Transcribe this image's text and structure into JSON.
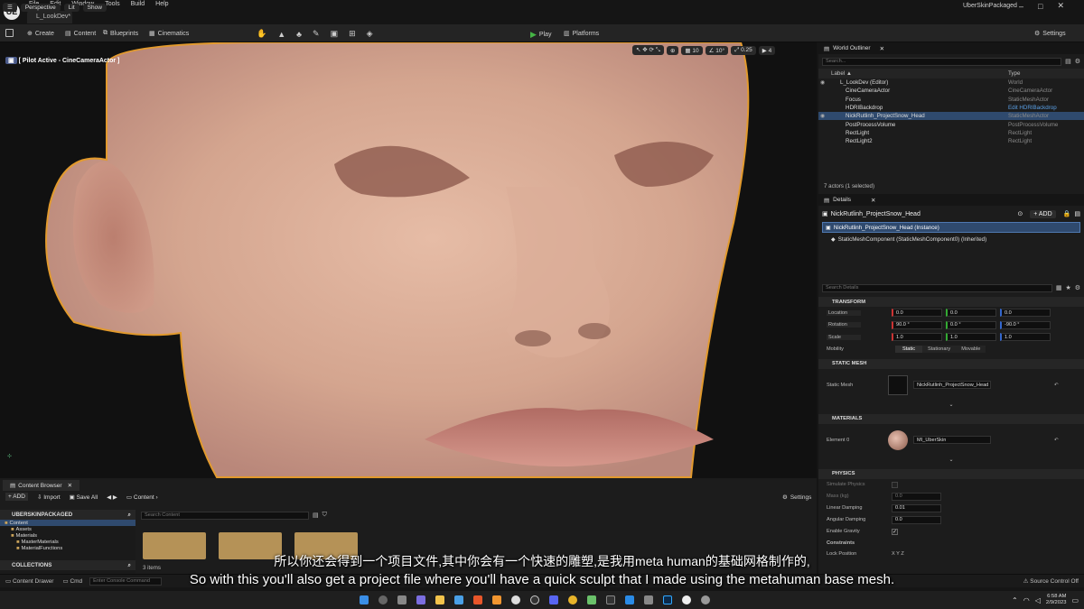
{
  "app": {
    "project_name": "UberSkinPackaged",
    "level_tab": "L_LookDev*",
    "logo": "UE"
  },
  "menu": [
    "File",
    "Edit",
    "Window",
    "Tools",
    "Build",
    "Help"
  ],
  "toolbar": {
    "create": "Create",
    "content": "Content",
    "blueprints": "Blueprints",
    "cinematics": "Cinematics",
    "play": "Play",
    "platforms": "Platforms",
    "settings": "Settings"
  },
  "viewport": {
    "perspective": "Perspective",
    "lit": "Lit",
    "show": "Show",
    "pilot": "[ Pilot Active - CineCameraActor ]",
    "grid_value": "10",
    "angle_value": "10°",
    "scale_value": "0.25",
    "camera_speed": "4"
  },
  "outliner": {
    "title": "World Outliner",
    "search_placeholder": "Search...",
    "col_label": "Label ▲",
    "col_type": "Type",
    "rows": [
      {
        "label": "L_LookDev (Editor)",
        "type": "World"
      },
      {
        "label": "CineCameraActor",
        "type": "CineCameraActor"
      },
      {
        "label": "Focus",
        "type": "StaticMeshActor"
      },
      {
        "label": "HDRIBackdrop",
        "type": "Edit HDRIBackdrop"
      },
      {
        "label": "NickRutlinh_ProjectSnow_Head",
        "type": "StaticMeshActor"
      },
      {
        "label": "PostProcessVolume",
        "type": "PostProcessVolume"
      },
      {
        "label": "RectLight",
        "type": "RectLight"
      },
      {
        "label": "RectLight2",
        "type": "RectLight"
      }
    ],
    "status": "7 actors (1 selected)"
  },
  "details": {
    "title": "Details",
    "actor_name": "NickRutlinh_ProjectSnow_Head",
    "add": "+ ADD",
    "instance": "NickRutlinh_ProjectSnow_Head (Instance)",
    "component": "StaticMeshComponent (StaticMeshComponent0) (Inherited)",
    "search_placeholder": "Search Details",
    "transform": {
      "header": "TRANSFORM",
      "location_label": "Location",
      "location": [
        "0.0",
        "0.0",
        "0.0"
      ],
      "rotation_label": "Rotation",
      "rotation": [
        "90.0 °",
        "0.0 °",
        "-90.0 °"
      ],
      "scale_label": "Scale",
      "scale": [
        "1.0",
        "1.0",
        "1.0"
      ],
      "mobility_label": "Mobility",
      "mobility": [
        "Static",
        "Stationary",
        "Movable"
      ]
    },
    "static_mesh": {
      "header": "STATIC MESH",
      "label": "Static Mesh",
      "value": "NickRutlinh_ProjectSnow_Head"
    },
    "materials": {
      "header": "MATERIALS",
      "label": "Element 0",
      "value": "MI_UberSkin"
    },
    "physics": {
      "header": "PHYSICS",
      "simulate": "Simulate Physics",
      "mass_label": "Mass (kg)",
      "mass": "0.0",
      "linear_damping_label": "Linear Damping",
      "linear_damping": "0.01",
      "angular_damping_label": "Angular Damping",
      "angular_damping": "0.0",
      "gravity_label": "Enable Gravity",
      "constraints": "Constraints",
      "lock_position": "Lock Position"
    }
  },
  "content_browser": {
    "tab": "Content Browser",
    "add": "+ ADD",
    "import": "Import",
    "save_all": "Save All",
    "path": "Content",
    "settings": "Settings",
    "root": "UBERSKINPACKAGED",
    "tree": [
      "Content",
      "Assets",
      "Materials",
      "MasterMaterials",
      "MaterialFunctions"
    ],
    "search_placeholder": "Search Content",
    "items_count": "3 items",
    "collections": "COLLECTIONS"
  },
  "statusbar": {
    "drawer": "Content Drawer",
    "cmd": "Cmd",
    "console_placeholder": "Enter Console Command",
    "source_control": "Source Control Off"
  },
  "subtitles": {
    "zh": "所以你还会得到一个项目文件,其中你会有一个快速的雕塑,是我用meta human的基础网格制作的,",
    "en": "So with this you'll also get a project file where you'll have a quick sculpt that I made using the metahuman base mesh."
  },
  "taskbar": {
    "time": "6:58 AM",
    "date": "2/9/2023"
  },
  "colors": {
    "accent": "#f5a623",
    "selection": "#2f4a6e",
    "play": "#45b545"
  }
}
